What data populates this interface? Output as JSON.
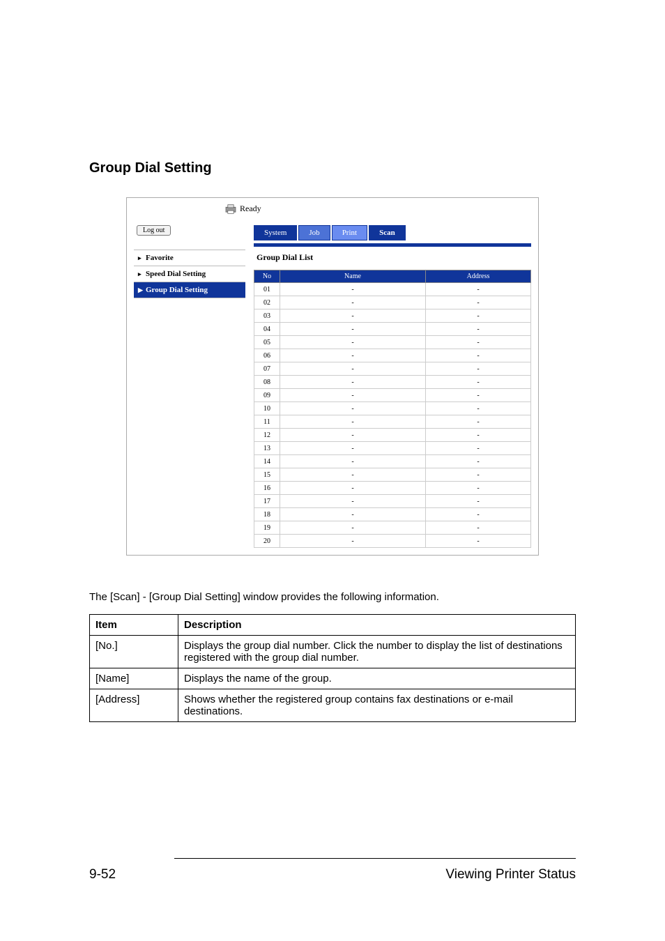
{
  "section": {
    "title": "Group Dial Setting"
  },
  "shot": {
    "status": "Ready",
    "logout": "Log out",
    "tabs": {
      "system": "System",
      "job": "Job",
      "print": "Print",
      "scan": "Scan"
    },
    "side": {
      "favorite": "Favorite",
      "speed_dial": "Speed Dial Setting",
      "group_dial": "Group Dial Setting"
    },
    "pane_title": "Group Dial List",
    "table_head": {
      "no": "No",
      "name": "Name",
      "address": "Address"
    },
    "rows": [
      {
        "no": "01",
        "name": "-",
        "address": "-"
      },
      {
        "no": "02",
        "name": "-",
        "address": "-"
      },
      {
        "no": "03",
        "name": "-",
        "address": "-"
      },
      {
        "no": "04",
        "name": "-",
        "address": "-"
      },
      {
        "no": "05",
        "name": "-",
        "address": "-"
      },
      {
        "no": "06",
        "name": "-",
        "address": "-"
      },
      {
        "no": "07",
        "name": "-",
        "address": "-"
      },
      {
        "no": "08",
        "name": "-",
        "address": "-"
      },
      {
        "no": "09",
        "name": "-",
        "address": "-"
      },
      {
        "no": "10",
        "name": "-",
        "address": "-"
      },
      {
        "no": "11",
        "name": "-",
        "address": "-"
      },
      {
        "no": "12",
        "name": "-",
        "address": "-"
      },
      {
        "no": "13",
        "name": "-",
        "address": "-"
      },
      {
        "no": "14",
        "name": "-",
        "address": "-"
      },
      {
        "no": "15",
        "name": "-",
        "address": "-"
      },
      {
        "no": "16",
        "name": "-",
        "address": "-"
      },
      {
        "no": "17",
        "name": "-",
        "address": "-"
      },
      {
        "no": "18",
        "name": "-",
        "address": "-"
      },
      {
        "no": "19",
        "name": "-",
        "address": "-"
      },
      {
        "no": "20",
        "name": "-",
        "address": "-"
      }
    ]
  },
  "desc": {
    "intro": "The [Scan] - [Group Dial Setting] window provides the following information.",
    "head_item": "Item",
    "head_desc": "Description",
    "rows": [
      {
        "item": "[No.]",
        "desc": "Displays the group dial number. Click the number to display the list of destinations registered with the group dial number."
      },
      {
        "item": "[Name]",
        "desc": "Displays the name of the group."
      },
      {
        "item": "[Address]",
        "desc": "Shows whether the registered group contains fax destinations or e-mail destinations."
      }
    ]
  },
  "footer": {
    "page": "9-52",
    "title": "Viewing Printer Status"
  }
}
